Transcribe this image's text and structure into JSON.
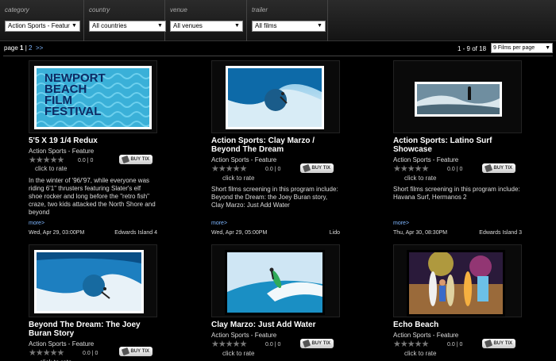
{
  "filters": [
    {
      "label": "category",
      "value": "Action Sports - Featur"
    },
    {
      "label": "country",
      "value": "All countries"
    },
    {
      "label": "venue",
      "value": "All venues"
    },
    {
      "label": "trailer",
      "value": "All films"
    }
  ],
  "pager": {
    "page_word": "page",
    "current": "1",
    "sep": "|",
    "next_page": "2",
    "next_arrows": ">>"
  },
  "range_text": "1 - 9 of 18",
  "per_page": "9 Films per page",
  "card_common": {
    "rating": "0.0 | 0",
    "click_to_rate": "click to rate",
    "buy_label": "BUY TIX",
    "more": "more>"
  },
  "logo_text": [
    "NEWPORT",
    "BEACH",
    "FILM",
    "FESTIVAL"
  ],
  "films": [
    {
      "title": "5'5 X 19 1/4 Redux",
      "category": "Action Sports - Feature",
      "description": "In the winter of '96/'97, while everyone was riding 6'1\" thrusters featuring Slater's elf shoe rocker and long before the \"retro fish\" craze, two kids attacked the North Shore and beyond",
      "date": "Wed, Apr 29, 03:00PM",
      "venue": "Edwards Island 4"
    },
    {
      "title": "Action Sports: Clay Marzo / Beyond The Dream",
      "category": "Action Sports - Feature",
      "description": "Short films screening in this program include: Beyond the Dream: the Joey Buran story, Clay Marzo: Just Add Water",
      "date": "Wed, Apr 29, 05:00PM",
      "venue": "Lido"
    },
    {
      "title": "Action Sports: Latino Surf Showcase",
      "category": "Action Sports - Feature",
      "description": "Short films screening in this program include: Havana Surf, Hermanos 2",
      "date": "Thu, Apr 30, 08:30PM",
      "venue": "Edwards Island 3"
    },
    {
      "title": "Beyond The Dream: The Joey Buran Story",
      "category": "Action Sports - Feature"
    },
    {
      "title": "Clay Marzo: Just Add Water",
      "category": "Action Sports - Feature"
    },
    {
      "title": "Echo Beach",
      "category": "Action Sports - Feature"
    }
  ],
  "colors": {
    "background": "#000000",
    "link": "#7fb6ff",
    "logo_bg": "#3ab0d8",
    "logo_text": "#0d2a63"
  }
}
